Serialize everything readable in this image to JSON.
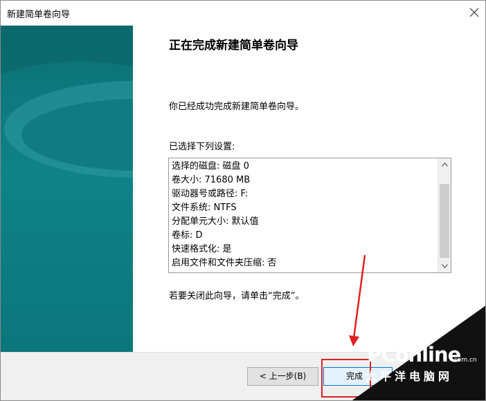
{
  "window": {
    "title": "新建简单卷向导",
    "close_icon": "close-icon"
  },
  "content": {
    "heading": "正在完成新建简单卷向导",
    "success_message": "你已经成功完成新建简单卷向导。",
    "settings_label": "已选择下列设置:",
    "settings": [
      "选择的磁盘: 磁盘 0",
      "卷大小: 71680 MB",
      "驱动器号或路径: F:",
      "文件系统: NTFS",
      "分配单元大小: 默认值",
      "卷标: D",
      "快速格式化: 是",
      "启用文件和文件夹压缩: 否"
    ],
    "close_hint": "若要关闭此向导，请单击“完成”。"
  },
  "buttons": {
    "back": "< 上一步(B)",
    "finish": "完成"
  },
  "watermark": {
    "brand": "PConline",
    "domain": ".com.cn",
    "chinese": "太平洋电脑网"
  },
  "colors": {
    "banner": "#0f8388",
    "annotation": "#e02020",
    "finish_border": "#0078d7"
  }
}
